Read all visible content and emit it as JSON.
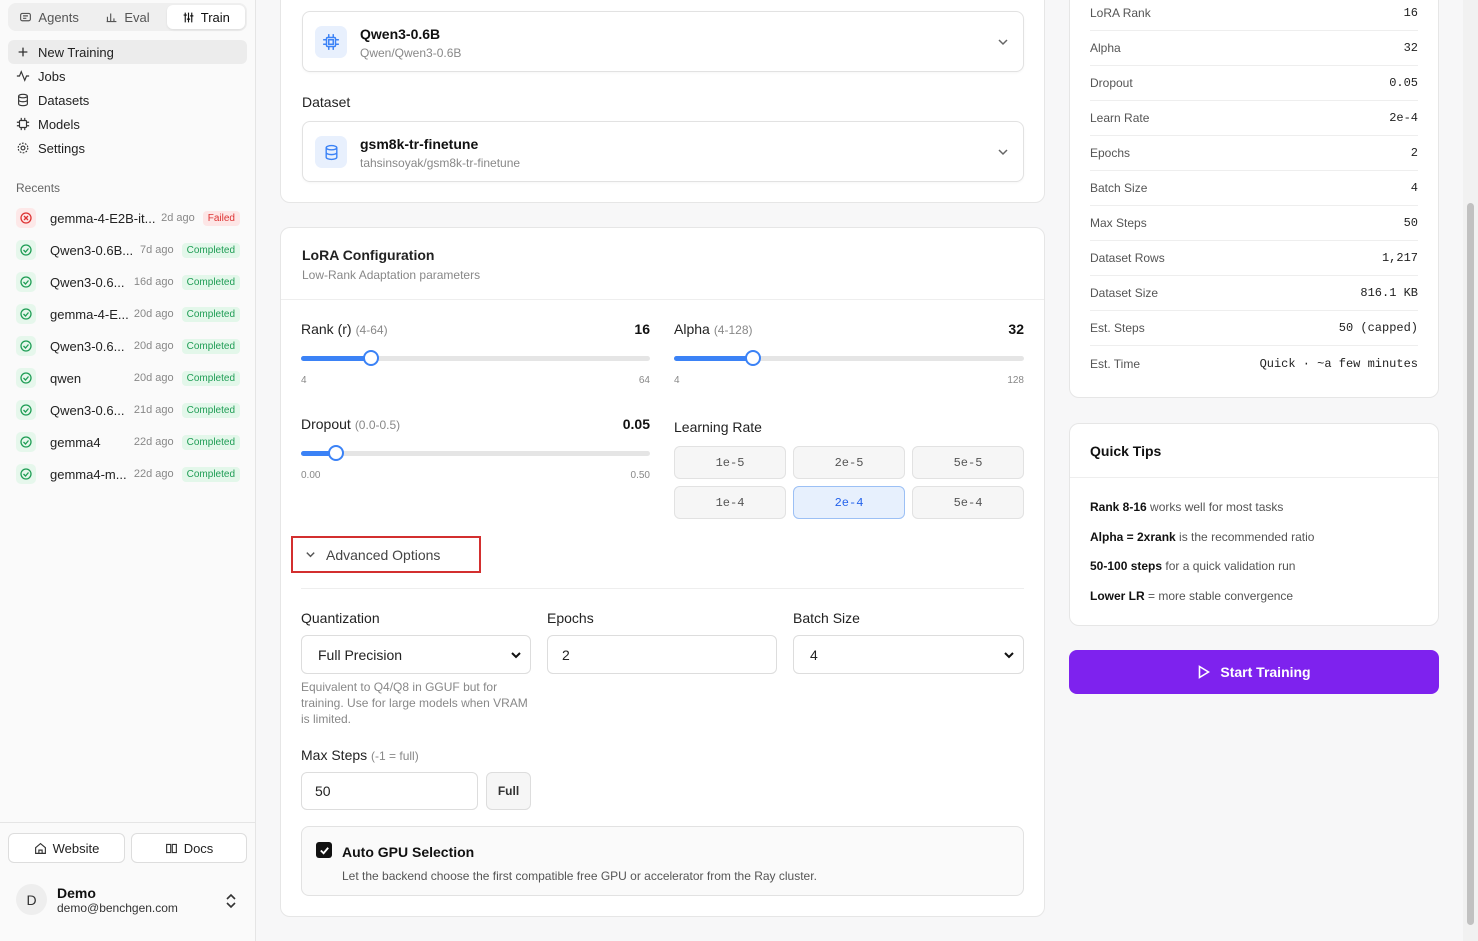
{
  "sidebar": {
    "tabs": [
      {
        "label": "Agents"
      },
      {
        "label": "Eval"
      },
      {
        "label": "Train"
      }
    ],
    "nav": [
      {
        "label": "New Training"
      },
      {
        "label": "Jobs"
      },
      {
        "label": "Datasets"
      },
      {
        "label": "Models"
      },
      {
        "label": "Settings"
      }
    ],
    "recents_title": "Recents",
    "recents": [
      {
        "name": "gemma-4-E2B-it...",
        "ago": "2d ago",
        "status": "Failed"
      },
      {
        "name": "Qwen3-0.6B...",
        "ago": "7d ago",
        "status": "Completed"
      },
      {
        "name": "Qwen3-0.6...",
        "ago": "16d ago",
        "status": "Completed"
      },
      {
        "name": "gemma-4-E...",
        "ago": "20d ago",
        "status": "Completed"
      },
      {
        "name": "Qwen3-0.6...",
        "ago": "20d ago",
        "status": "Completed"
      },
      {
        "name": "qwen",
        "ago": "20d ago",
        "status": "Completed"
      },
      {
        "name": "Qwen3-0.6...",
        "ago": "21d ago",
        "status": "Completed"
      },
      {
        "name": "gemma4",
        "ago": "22d ago",
        "status": "Completed"
      },
      {
        "name": "gemma4-m...",
        "ago": "22d ago",
        "status": "Completed"
      }
    ],
    "website_label": "Website",
    "docs_label": "Docs",
    "user": {
      "initial": "D",
      "name": "Demo",
      "email": "demo@benchgen.com"
    }
  },
  "model": {
    "name": "Qwen3-0.6B",
    "path": "Qwen/Qwen3-0.6B"
  },
  "dataset": {
    "label": "Dataset",
    "name": "gsm8k-tr-finetune",
    "path": "tahsinsoyak/gsm8k-tr-finetune"
  },
  "lora": {
    "title": "LoRA Configuration",
    "subtitle": "Low-Rank Adaptation parameters",
    "rank": {
      "label": "Rank (r)",
      "range": "(4-64)",
      "value": "16",
      "min": "4",
      "max": "64",
      "fraction": 0.2
    },
    "alpha": {
      "label": "Alpha",
      "range": "(4-128)",
      "value": "32",
      "min": "4",
      "max": "128",
      "fraction": 0.226
    },
    "dropout": {
      "label": "Dropout",
      "range": "(0.0-0.5)",
      "value": "0.05",
      "min": "0.00",
      "max": "0.50",
      "fraction": 0.1
    },
    "learning_rate": {
      "label": "Learning Rate",
      "options": [
        "1e-5",
        "2e-5",
        "5e-5",
        "1e-4",
        "2e-4",
        "5e-4"
      ],
      "selected": "2e-4"
    }
  },
  "advanced": {
    "toggle_label": "Advanced Options",
    "quantization": {
      "label": "Quantization",
      "value": "Full Precision",
      "hint": "Equivalent to Q4/Q8 in GGUF but for training. Use for large models when VRAM is limited."
    },
    "epochs": {
      "label": "Epochs",
      "value": "2"
    },
    "batch_size": {
      "label": "Batch Size",
      "value": "4"
    },
    "max_steps": {
      "label": "Max Steps",
      "note": "(-1 = full)",
      "value": "50",
      "full_label": "Full"
    },
    "gpu": {
      "title": "Auto GPU Selection",
      "desc": "Let the backend choose the first compatible free GPU or accelerator from the Ray cluster.",
      "checked": true
    }
  },
  "summary": [
    {
      "k": "LoRA Rank",
      "v": "16"
    },
    {
      "k": "Alpha",
      "v": "32"
    },
    {
      "k": "Dropout",
      "v": "0.05"
    },
    {
      "k": "Learn Rate",
      "v": "2e-4"
    },
    {
      "k": "Epochs",
      "v": "2"
    },
    {
      "k": "Batch Size",
      "v": "4"
    },
    {
      "k": "Max Steps",
      "v": "50"
    },
    {
      "k": "Dataset Rows",
      "v": "1,217"
    },
    {
      "k": "Dataset Size",
      "v": "816.1 KB"
    },
    {
      "k": "Est. Steps",
      "v": "50 (capped)"
    },
    {
      "k": "Est. Time",
      "v": "Quick · ~a few minutes"
    }
  ],
  "tips": {
    "title": "Quick Tips",
    "items": [
      {
        "bold": "Rank 8-16",
        "rest": " works well for most tasks"
      },
      {
        "bold": "Alpha = 2xrank",
        "rest": " is the recommended ratio"
      },
      {
        "bold": "50-100 steps",
        "rest": " for a quick validation run"
      },
      {
        "bold": "Lower LR",
        "rest": " = more stable convergence"
      }
    ]
  },
  "start_label": "Start Training",
  "colors": {
    "accent": "#7e22ee",
    "slider": "#3b82f6",
    "success": "#1f9d55",
    "danger": "#dd3333",
    "highlight": "#d32f2f"
  }
}
